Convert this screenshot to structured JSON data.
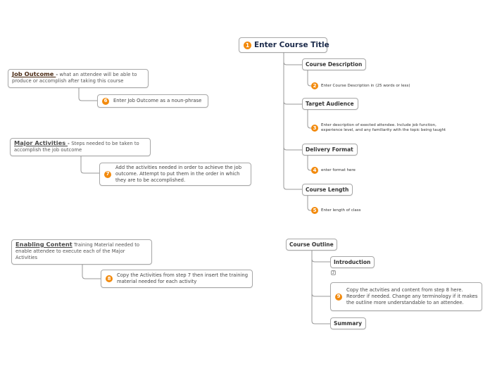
{
  "diagram": {
    "type": "mind-map",
    "accent_color": "#f28a0d",
    "root": {
      "badge": "1",
      "label": "Enter Course Title"
    },
    "right_branches": [
      {
        "label": "Course Description",
        "step": {
          "badge": "2",
          "text": "Enter Course Description in (25 words or less)"
        }
      },
      {
        "label": "Target Audience",
        "step": {
          "badge": "3",
          "text": "Enter description of exected attendee.  Include job function, experience level, and any familiarity with the topic being taught"
        }
      },
      {
        "label": "Delivery Format",
        "step": {
          "badge": "4",
          "text": "enter format here"
        }
      },
      {
        "label": "Course Length",
        "step": {
          "badge": "5",
          "text": "Enter length of class"
        }
      }
    ],
    "left_topics": [
      {
        "heading": "Job Outcome ",
        "separator": "- ",
        "description": "what an attendee will be able to produce or accomplish after taking this course",
        "step": {
          "badge": "6",
          "text": "Enter Job Outcome as a noun-phrase"
        }
      },
      {
        "heading": "Major Activities ",
        "separator": "- ",
        "description": "Steps needed to be taken to accomplish the job outcome",
        "step": {
          "badge": "7",
          "text": "Add the activities needed in order to achieve the job outcome.   Attempt to put them in the order in which they are to be accomplished."
        }
      },
      {
        "heading": "Enabling Content",
        "separator": " ",
        "description": "Training Material needed to enable attendee to execute each of the Major Activities",
        "step": {
          "badge": "8",
          "text": "Copy the Activities from step 7 then insert the training material needed for each activity"
        }
      }
    ],
    "outline": {
      "label": "Course Outline",
      "children": [
        {
          "label": "Introduction",
          "collapsed_count": "2"
        },
        {
          "badge": "9",
          "text": "Copy the actvities and content from step 8 here.  Reorder if needed.  Change any terminology if it makes the outline more understandable to an attendee."
        },
        {
          "label": "Summary"
        }
      ]
    }
  }
}
